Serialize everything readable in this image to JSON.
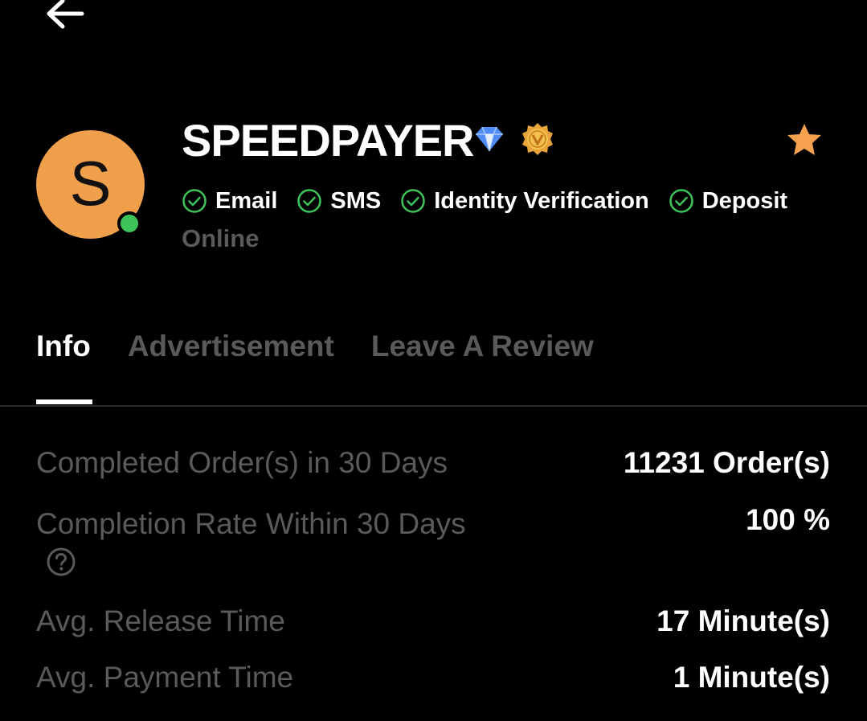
{
  "merchant": {
    "initial": "S",
    "name": "SPEEDPAYER",
    "status": "Online"
  },
  "icons": {
    "back": "arrow-left-icon",
    "verified": "diamond-icon",
    "badge": "vip-badge-icon",
    "favorite": "star-icon",
    "check": "check-circle-icon",
    "help": "question-circle-icon"
  },
  "verifications": [
    {
      "label": "Email"
    },
    {
      "label": "SMS"
    },
    {
      "label": "Identity Verification"
    },
    {
      "label": "Deposit"
    }
  ],
  "tabs": [
    {
      "label": "Info",
      "active": true
    },
    {
      "label": "Advertisement",
      "active": false
    },
    {
      "label": "Leave A Review",
      "active": false
    }
  ],
  "stats": {
    "completed_orders": {
      "label": "Completed Order(s) in 30 Days",
      "value": "11231 Order(s)"
    },
    "completion_rate": {
      "label": "Completion Rate Within 30 Days",
      "value": "100 %"
    },
    "release_time": {
      "label": "Avg. Release Time",
      "value": "17 Minute(s)"
    },
    "payment_time": {
      "label": "Avg. Payment Time",
      "value": "1 Minute(s)"
    }
  },
  "colors": {
    "background": "#000000",
    "avatar": "#f0a04b",
    "online_dot": "#3ec35a",
    "check_green": "#3ec35a",
    "star": "#f5a14e",
    "diamond": "#4f8cf5",
    "muted_text": "#5a5a5a"
  }
}
